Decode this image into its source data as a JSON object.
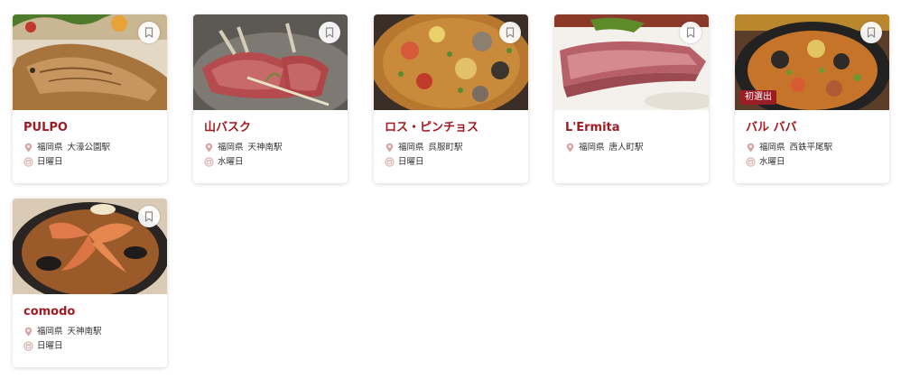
{
  "restaurants": [
    {
      "name": "PULPO",
      "prefecture": "福岡県",
      "station": "大濠公園駅",
      "closed": "日曜日",
      "badge": ""
    },
    {
      "name": "山バスク",
      "prefecture": "福岡県",
      "station": "天神南駅",
      "closed": "水曜日",
      "badge": ""
    },
    {
      "name": "ロス・ピンチョス",
      "prefecture": "福岡県",
      "station": "呉服町駅",
      "closed": "日曜日",
      "badge": ""
    },
    {
      "name": "L'Ermita",
      "prefecture": "福岡県",
      "station": "唐人町駅",
      "closed": "",
      "badge": ""
    },
    {
      "name": "バル ババ",
      "prefecture": "福岡県",
      "station": "西鉄平尾駅",
      "closed": "水曜日",
      "badge": "初選出"
    },
    {
      "name": "comodo",
      "prefecture": "福岡県",
      "station": "天神南駅",
      "closed": "日曜日",
      "badge": ""
    }
  ],
  "icons": {
    "location": "map-pin-icon",
    "closed_day": "calendar-closed-icon",
    "bookmark": "bookmark-icon"
  },
  "colors": {
    "accent": "#a11b22",
    "badge": "#9b1c24",
    "icon": "#d9a7a3"
  }
}
